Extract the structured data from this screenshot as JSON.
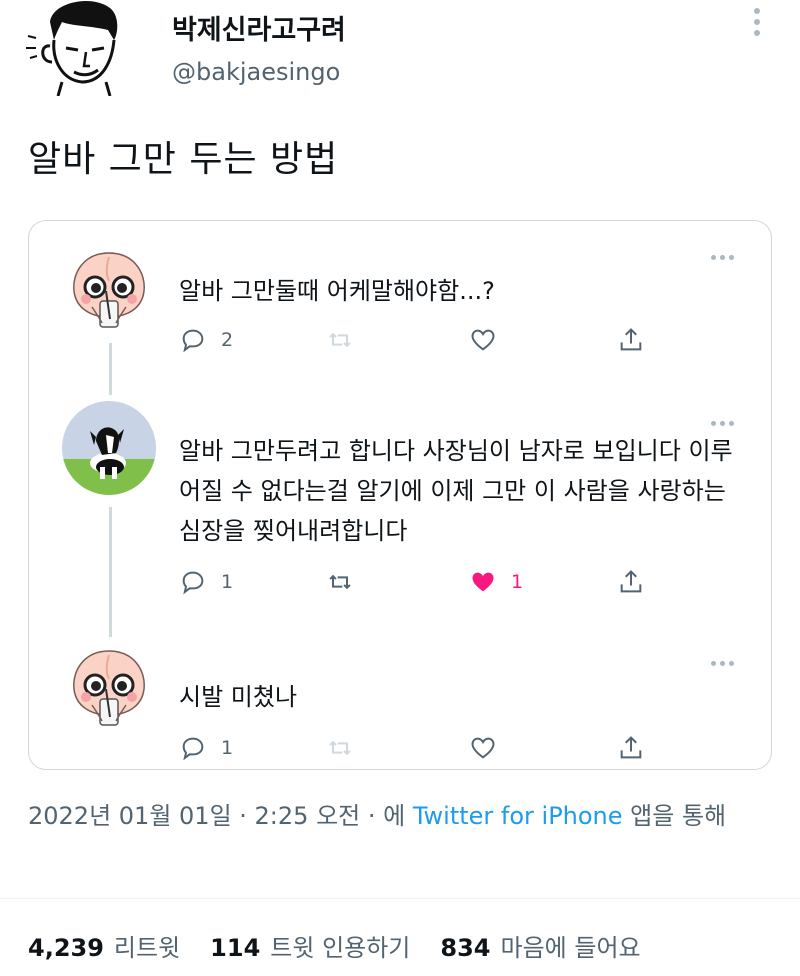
{
  "author": {
    "name": "박제신라고구려",
    "handle": "@bakjaesingo"
  },
  "tweet": {
    "text": "알바 그만 두는 방법"
  },
  "quoted_thread": [
    {
      "text": "알바 그만둘때 어케말해야함...?",
      "avatar": "peach-character-avatar",
      "reply_count": "2",
      "retweet_count": "",
      "like_count": "",
      "liked": false
    },
    {
      "text": "알바 그만두려고 합니다 사장님이 남자로 보입니다 이루어질 수 없다는걸 알기에 이제 그만 이 사람을 사랑하는 심장을 찢어내려합니다",
      "avatar": "border-collie-dog-avatar",
      "reply_count": "1",
      "retweet_count": "",
      "like_count": "1",
      "liked": true
    },
    {
      "text": "시발 미쳤나",
      "avatar": "peach-character-avatar",
      "reply_count": "1",
      "retweet_count": "",
      "like_count": "",
      "liked": false
    }
  ],
  "meta": {
    "datetime": "2022년 01월 01일 · 2:25 오전 · 에 ",
    "source": "Twitter for iPhone",
    "suffix": " 앱을 통해"
  },
  "stats": {
    "retweets": "4,239",
    "retweets_label": "리트윗",
    "quotes": "114",
    "quotes_label": "트윗 인용하기",
    "likes": "834",
    "likes_label": "마음에 들어요"
  },
  "colors": {
    "text": "#0f1419",
    "secondary": "#536471",
    "link": "#1d9bf0",
    "like": "#f91880",
    "border": "#cfd9de"
  }
}
